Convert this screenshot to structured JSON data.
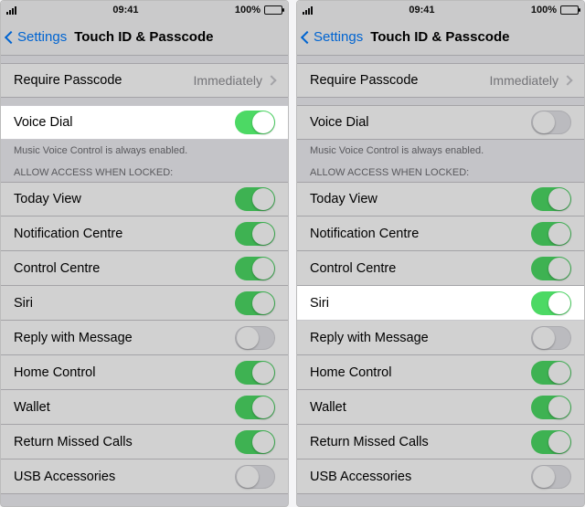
{
  "status": {
    "time": "09:41",
    "battery": "100%"
  },
  "nav": {
    "back": "Settings",
    "title": "Touch ID & Passcode"
  },
  "require": {
    "label": "Require Passcode",
    "value": "Immediately"
  },
  "voiceDial": {
    "label": "Voice Dial",
    "footer": "Music Voice Control is always enabled."
  },
  "allowHeader": "Allow Access When Locked:",
  "items": {
    "today": {
      "label": "Today View"
    },
    "notif": {
      "label": "Notification Centre"
    },
    "control": {
      "label": "Control Centre"
    },
    "siri": {
      "label": "Siri"
    },
    "reply": {
      "label": "Reply with Message"
    },
    "home": {
      "label": "Home Control"
    },
    "wallet": {
      "label": "Wallet"
    },
    "missed": {
      "label": "Return Missed Calls"
    },
    "usb": {
      "label": "USB Accessories"
    }
  },
  "left": {
    "highlight": "voiceDial",
    "states": {
      "voiceDial": true,
      "today": true,
      "notif": true,
      "control": true,
      "siri": true,
      "reply": false,
      "home": true,
      "wallet": true,
      "missed": true,
      "usb": false
    }
  },
  "right": {
    "highlight": "siri",
    "states": {
      "voiceDial": false,
      "today": true,
      "notif": true,
      "control": true,
      "siri": true,
      "reply": false,
      "home": true,
      "wallet": true,
      "missed": true,
      "usb": false
    }
  }
}
